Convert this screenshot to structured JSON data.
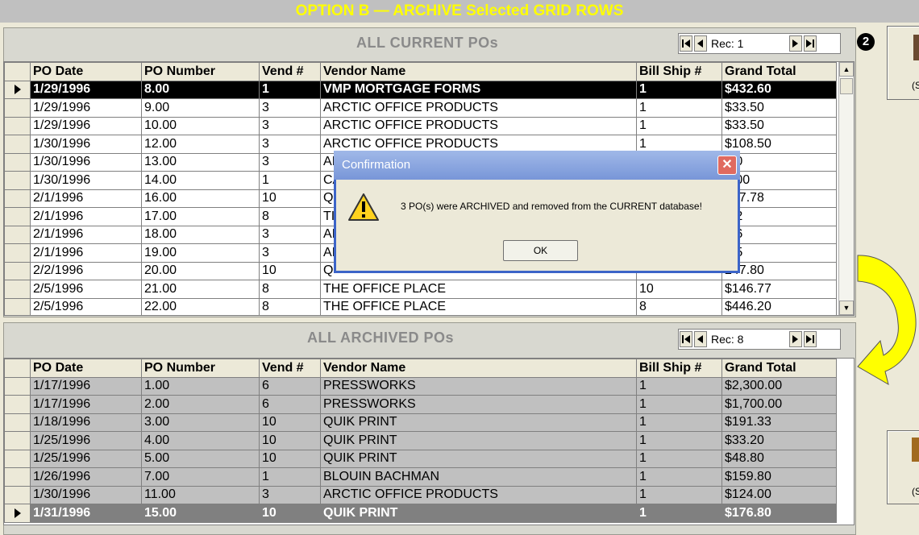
{
  "banner": {
    "title": "OPTION B — ARCHIVE Selected GRID ROWS"
  },
  "step_badge": "2",
  "current": {
    "title": "ALL CURRENT POs",
    "record_label": "Rec: 1",
    "columns": [
      "PO Date",
      "PO Number",
      "Vend #",
      "Vendor Name",
      "Bill Ship #",
      "Grand Total"
    ],
    "rows": [
      [
        "1/29/1996",
        "8.00",
        "1",
        "VMP MORTGAGE FORMS",
        "1",
        "$432.60"
      ],
      [
        "1/29/1996",
        "9.00",
        "3",
        "ARCTIC OFFICE PRODUCTS",
        "1",
        "$33.50"
      ],
      [
        "1/29/1996",
        "10.00",
        "3",
        "ARCTIC OFFICE PRODUCTS",
        "1",
        "$33.50"
      ],
      [
        "1/30/1996",
        "12.00",
        "3",
        "ARCTIC OFFICE PRODUCTS",
        "1",
        "$108.50"
      ],
      [
        "1/30/1996",
        "13.00",
        "3",
        "AI",
        "",
        ".00"
      ],
      [
        "1/30/1996",
        "14.00",
        "1",
        "CA",
        "",
        "0.00"
      ],
      [
        "2/1/1996",
        "16.00",
        "10",
        "Q",
        "",
        "667.78"
      ],
      [
        "2/1/1996",
        "17.00",
        "8",
        "TI",
        "",
        ".92"
      ],
      [
        "2/1/1996",
        "18.00",
        "3",
        "AI",
        "",
        ".26"
      ],
      [
        "2/1/1996",
        "19.00",
        "3",
        "AI",
        "",
        ".75"
      ],
      [
        "2/2/1996",
        "20.00",
        "10",
        "Q",
        "",
        "247.80"
      ],
      [
        "2/5/1996",
        "21.00",
        "8",
        "THE OFFICE PLACE",
        "10",
        "$146.77"
      ],
      [
        "2/5/1996",
        "22.00",
        "8",
        "THE OFFICE PLACE",
        "8",
        "$446.20"
      ]
    ]
  },
  "archived": {
    "title": "ALL ARCHIVED POs",
    "record_label": "Rec: 8",
    "columns": [
      "PO Date",
      "PO Number",
      "Vend #",
      "Vendor Name",
      "Bill Ship #",
      "Grand Total"
    ],
    "rows": [
      [
        "1/17/1996",
        "1.00",
        "6",
        "PRESSWORKS",
        "1",
        "$2,300.00"
      ],
      [
        "1/17/1996",
        "2.00",
        "6",
        "PRESSWORKS",
        "1",
        "$1,700.00"
      ],
      [
        "1/18/1996",
        "3.00",
        "10",
        "QUIK PRINT",
        "1",
        "$191.33"
      ],
      [
        "1/25/1996",
        "4.00",
        "10",
        "QUIK PRINT",
        "1",
        "$33.20"
      ],
      [
        "1/25/1996",
        "5.00",
        "10",
        "QUIK PRINT",
        "1",
        "$48.80"
      ],
      [
        "1/26/1996",
        "7.00",
        "1",
        "BLOUIN BACHMAN",
        "1",
        "$159.80"
      ],
      [
        "1/30/1996",
        "11.00",
        "3",
        "ARCTIC OFFICE PRODUCTS",
        "1",
        "$124.00"
      ],
      [
        "1/31/1996",
        "15.00",
        "10",
        "QUIK PRINT",
        "1",
        "$176.80"
      ]
    ]
  },
  "dialog": {
    "title": "Confirmation",
    "message": "3 PO(s) were ARCHIVED and removed from the CURRENT database!",
    "ok_label": "OK",
    "close_glyph": "✕"
  },
  "side_buttons": {
    "top_partial": "(S",
    "bottom_partial": "(S"
  },
  "colors": {
    "banner_text": "#ffff00",
    "arrow": "#ffff00",
    "title_bar": "#7896d8"
  }
}
